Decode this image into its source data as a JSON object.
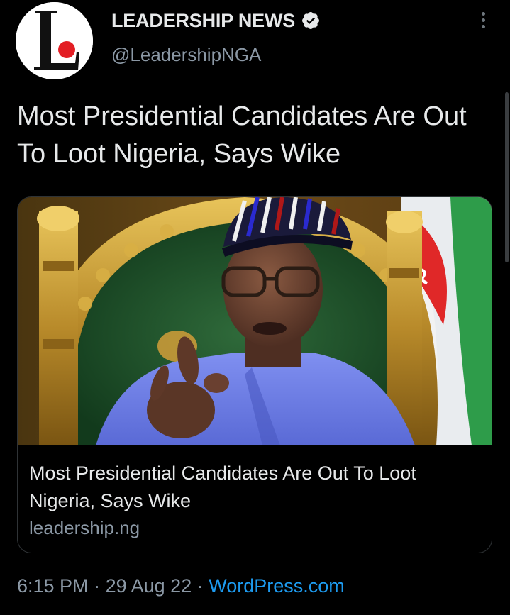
{
  "account": {
    "display_name": "LEADERSHIP NEWS",
    "handle": "@LeadershipNGA",
    "verified": true,
    "avatar_logo_text": "L"
  },
  "tweet": {
    "text": "Most Presidential Candidates Are Out To Loot Nigeria, Says Wike"
  },
  "link_card": {
    "title": "Most Presidential Candidates Are Out To Loot Nigeria, Says Wike",
    "domain": "leadership.ng",
    "image_icon": "news-photo"
  },
  "meta": {
    "time": "6:15 PM",
    "separator": "·",
    "date": "29 Aug 22",
    "source": "WordPress.com"
  },
  "colors": {
    "background": "#000000",
    "text": "#e7e9ea",
    "secondary": "#8b98a5",
    "link": "#1d9bf0",
    "border": "#2f3336",
    "verified_badge": "#e7e9ea",
    "logo_red": "#e31e24"
  },
  "icons": {
    "more": "more-vertical-icon",
    "verified": "verified-badge-icon"
  }
}
